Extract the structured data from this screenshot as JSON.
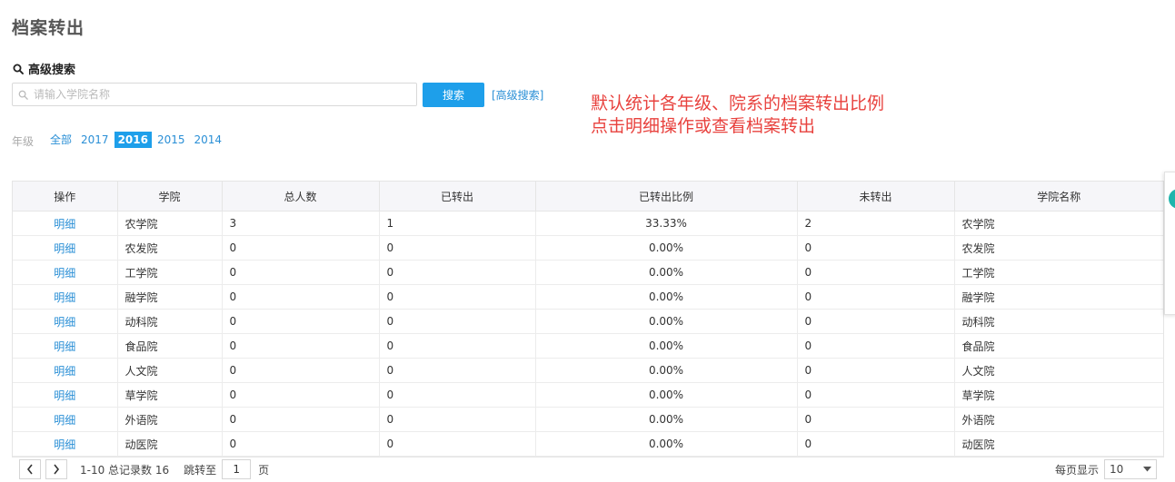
{
  "page": {
    "title": "档案转出"
  },
  "search": {
    "section_title": "高级搜索",
    "placeholder": "请输入学院名称",
    "button_label": "搜索",
    "advanced_link": "[高级搜索]"
  },
  "annotation": {
    "line1": "默认统计各年级、院系的档案转出比例",
    "line2": "点击明细操作或查看档案转出",
    "color": "#e8423e"
  },
  "year_filter": {
    "label": "年级",
    "options": [
      "全部",
      "2017",
      "2016",
      "2015",
      "2014"
    ],
    "selected": "2016"
  },
  "table": {
    "columns": [
      "操作",
      "学院",
      "总人数",
      "已转出",
      "已转出比例",
      "未转出",
      "学院名称"
    ],
    "rows": [
      [
        "明细",
        "农学院",
        "3",
        "1",
        "33.33%",
        "2",
        "农学院"
      ],
      [
        "明细",
        "农发院",
        "0",
        "0",
        "0.00%",
        "0",
        "农发院"
      ],
      [
        "明细",
        "工学院",
        "0",
        "0",
        "0.00%",
        "0",
        "工学院"
      ],
      [
        "明细",
        "融学院",
        "0",
        "0",
        "0.00%",
        "0",
        "融学院"
      ],
      [
        "明细",
        "动科院",
        "0",
        "0",
        "0.00%",
        "0",
        "动科院"
      ],
      [
        "明细",
        "食品院",
        "0",
        "0",
        "0.00%",
        "0",
        "食品院"
      ],
      [
        "明细",
        "人文院",
        "0",
        "0",
        "0.00%",
        "0",
        "人文院"
      ],
      [
        "明细",
        "草学院",
        "0",
        "0",
        "0.00%",
        "0",
        "草学院"
      ],
      [
        "明细",
        "外语院",
        "0",
        "0",
        "0.00%",
        "0",
        "外语院"
      ],
      [
        "明细",
        "动医院",
        "0",
        "0",
        "0.00%",
        "0",
        "动医院"
      ]
    ]
  },
  "pagination": {
    "prev": "‹",
    "next": "›",
    "info": "1-10 总记录数 16",
    "jump_label": "跳转至",
    "jump_value": "1",
    "page_unit": "页",
    "per_page_label": "每页显示",
    "per_page_value": "10"
  },
  "colors": {
    "accent": "#1e9fea",
    "link": "#2a8fd6",
    "side_dot": "#1fb5ac"
  },
  "icons": {
    "search": "search-icon",
    "dropdown": "caret-down-icon"
  }
}
